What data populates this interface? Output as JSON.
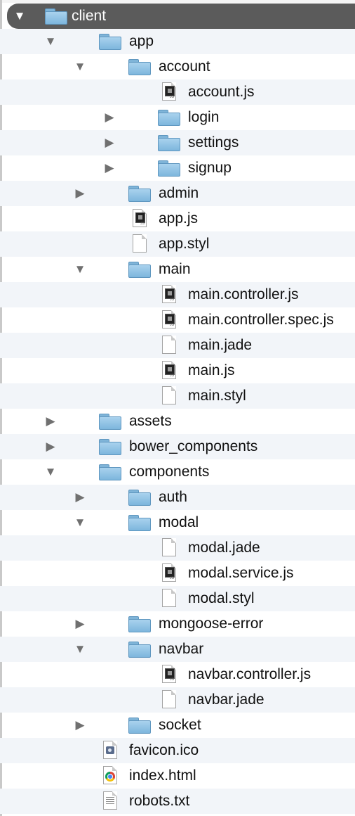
{
  "tree": [
    {
      "label": "client",
      "kind": "folder",
      "level": 0,
      "expanded": true,
      "selected": true
    },
    {
      "label": "app",
      "kind": "folder",
      "level": 1,
      "expanded": true
    },
    {
      "label": "account",
      "kind": "folder",
      "level": 2,
      "expanded": true
    },
    {
      "label": "account.js",
      "kind": "js-file",
      "level": 3
    },
    {
      "label": "login",
      "kind": "folder",
      "level": 3,
      "expanded": false
    },
    {
      "label": "settings",
      "kind": "folder",
      "level": 3,
      "expanded": false
    },
    {
      "label": "signup",
      "kind": "folder",
      "level": 3,
      "expanded": false
    },
    {
      "label": "admin",
      "kind": "folder",
      "level": 2,
      "expanded": false
    },
    {
      "label": "app.js",
      "kind": "js-file",
      "level": 2
    },
    {
      "label": "app.styl",
      "kind": "blank-file",
      "level": 2
    },
    {
      "label": "main",
      "kind": "folder",
      "level": 2,
      "expanded": true
    },
    {
      "label": "main.controller.js",
      "kind": "js-file",
      "level": 3
    },
    {
      "label": "main.controller.spec.js",
      "kind": "js-file",
      "level": 3
    },
    {
      "label": "main.jade",
      "kind": "blank-file",
      "level": 3
    },
    {
      "label": "main.js",
      "kind": "js-file",
      "level": 3
    },
    {
      "label": "main.styl",
      "kind": "blank-file",
      "level": 3
    },
    {
      "label": "assets",
      "kind": "folder",
      "level": 1,
      "expanded": false
    },
    {
      "label": "bower_components",
      "kind": "folder",
      "level": 1,
      "expanded": false
    },
    {
      "label": "components",
      "kind": "folder",
      "level": 1,
      "expanded": true
    },
    {
      "label": "auth",
      "kind": "folder",
      "level": 2,
      "expanded": false
    },
    {
      "label": "modal",
      "kind": "folder",
      "level": 2,
      "expanded": true
    },
    {
      "label": "modal.jade",
      "kind": "blank-file",
      "level": 3
    },
    {
      "label": "modal.service.js",
      "kind": "js-file",
      "level": 3
    },
    {
      "label": "modal.styl",
      "kind": "blank-file",
      "level": 3
    },
    {
      "label": "mongoose-error",
      "kind": "folder",
      "level": 2,
      "expanded": false
    },
    {
      "label": "navbar",
      "kind": "folder",
      "level": 2,
      "expanded": true
    },
    {
      "label": "navbar.controller.js",
      "kind": "js-file",
      "level": 3
    },
    {
      "label": "navbar.jade",
      "kind": "blank-file",
      "level": 3
    },
    {
      "label": "socket",
      "kind": "folder",
      "level": 2,
      "expanded": false
    },
    {
      "label": "favicon.ico",
      "kind": "ico-file",
      "level": 1
    },
    {
      "label": "index.html",
      "kind": "html-file",
      "level": 1
    },
    {
      "label": "robots.txt",
      "kind": "text-file",
      "level": 1
    }
  ],
  "icons": {
    "expanded": "disclosure-triangle-down-icon",
    "collapsed": "disclosure-triangle-right-icon",
    "folder": "folder-icon",
    "js-file": "javascript-file-icon",
    "blank-file": "blank-document-icon",
    "text-file": "text-document-icon",
    "ico-file": "ico-image-file-icon",
    "html-file": "chrome-html-file-icon"
  },
  "colors": {
    "selection": "#5b5b5b",
    "alt_row": "#f2f5f9",
    "folder": "#8cc0e4"
  }
}
